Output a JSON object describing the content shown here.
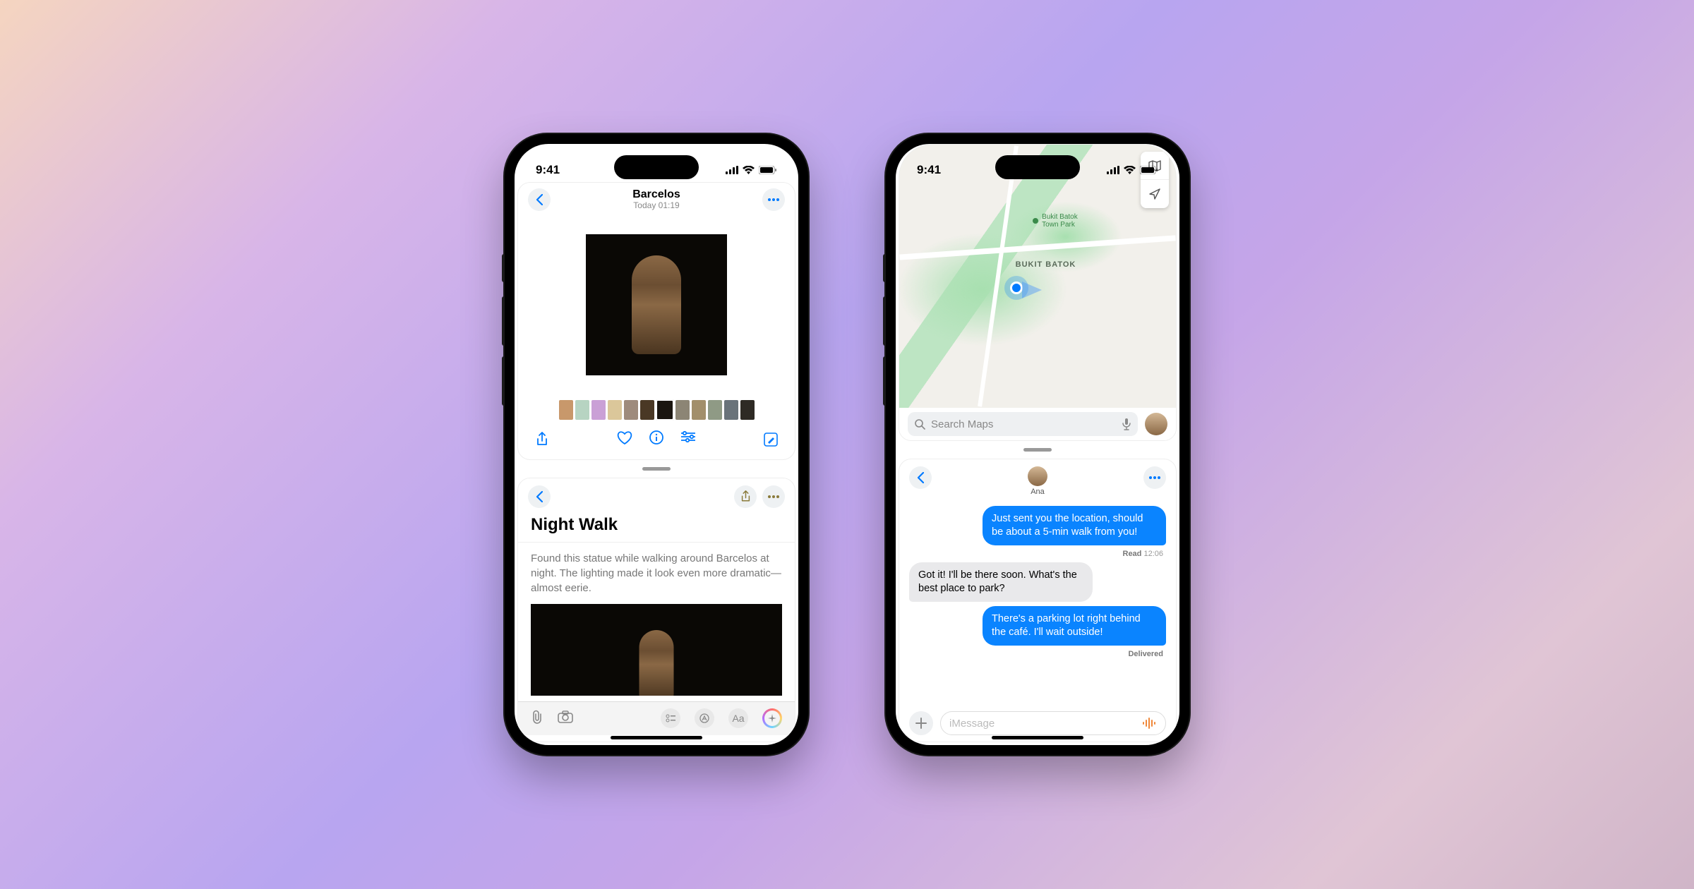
{
  "status": {
    "time": "9:41"
  },
  "phone1": {
    "top": {
      "title": "Barcelos",
      "subtitle": "Today 01:19",
      "thumb_colors": [
        "#c8986b",
        "#b7d4c2",
        "#caa0d6",
        "#dbc79a",
        "#9e8b7c",
        "#4a3825",
        "#1a1510",
        "#8c8575",
        "#a28f6b",
        "#8f9a85",
        "#69737a",
        "#2e2a24"
      ],
      "selected_thumb_index": 6
    },
    "bottom": {
      "title": "Night Walk",
      "body": "Found this statue while walking around Barcelos at night. The lighting made it look even more dramatic—almost eerie.",
      "toolbar_text_label": "Aa"
    }
  },
  "phone2": {
    "top": {
      "area_label": "BUKIT BATOK",
      "park_label": "Bukit Batok Town Park",
      "search_placeholder": "Search Maps"
    },
    "bottom": {
      "contact_name": "Ana",
      "messages": [
        {
          "dir": "out",
          "text": "Just sent you the location, should be about a 5-min walk from you!",
          "receipt_label": "Read",
          "receipt_time": "12:06"
        },
        {
          "dir": "in",
          "text": "Got it! I'll be there soon. What's the best place to park?"
        },
        {
          "dir": "out",
          "text": "There's a parking lot right behind the café. I'll wait outside!",
          "receipt_label": "Delivered"
        }
      ],
      "compose_placeholder": "iMessage"
    }
  }
}
